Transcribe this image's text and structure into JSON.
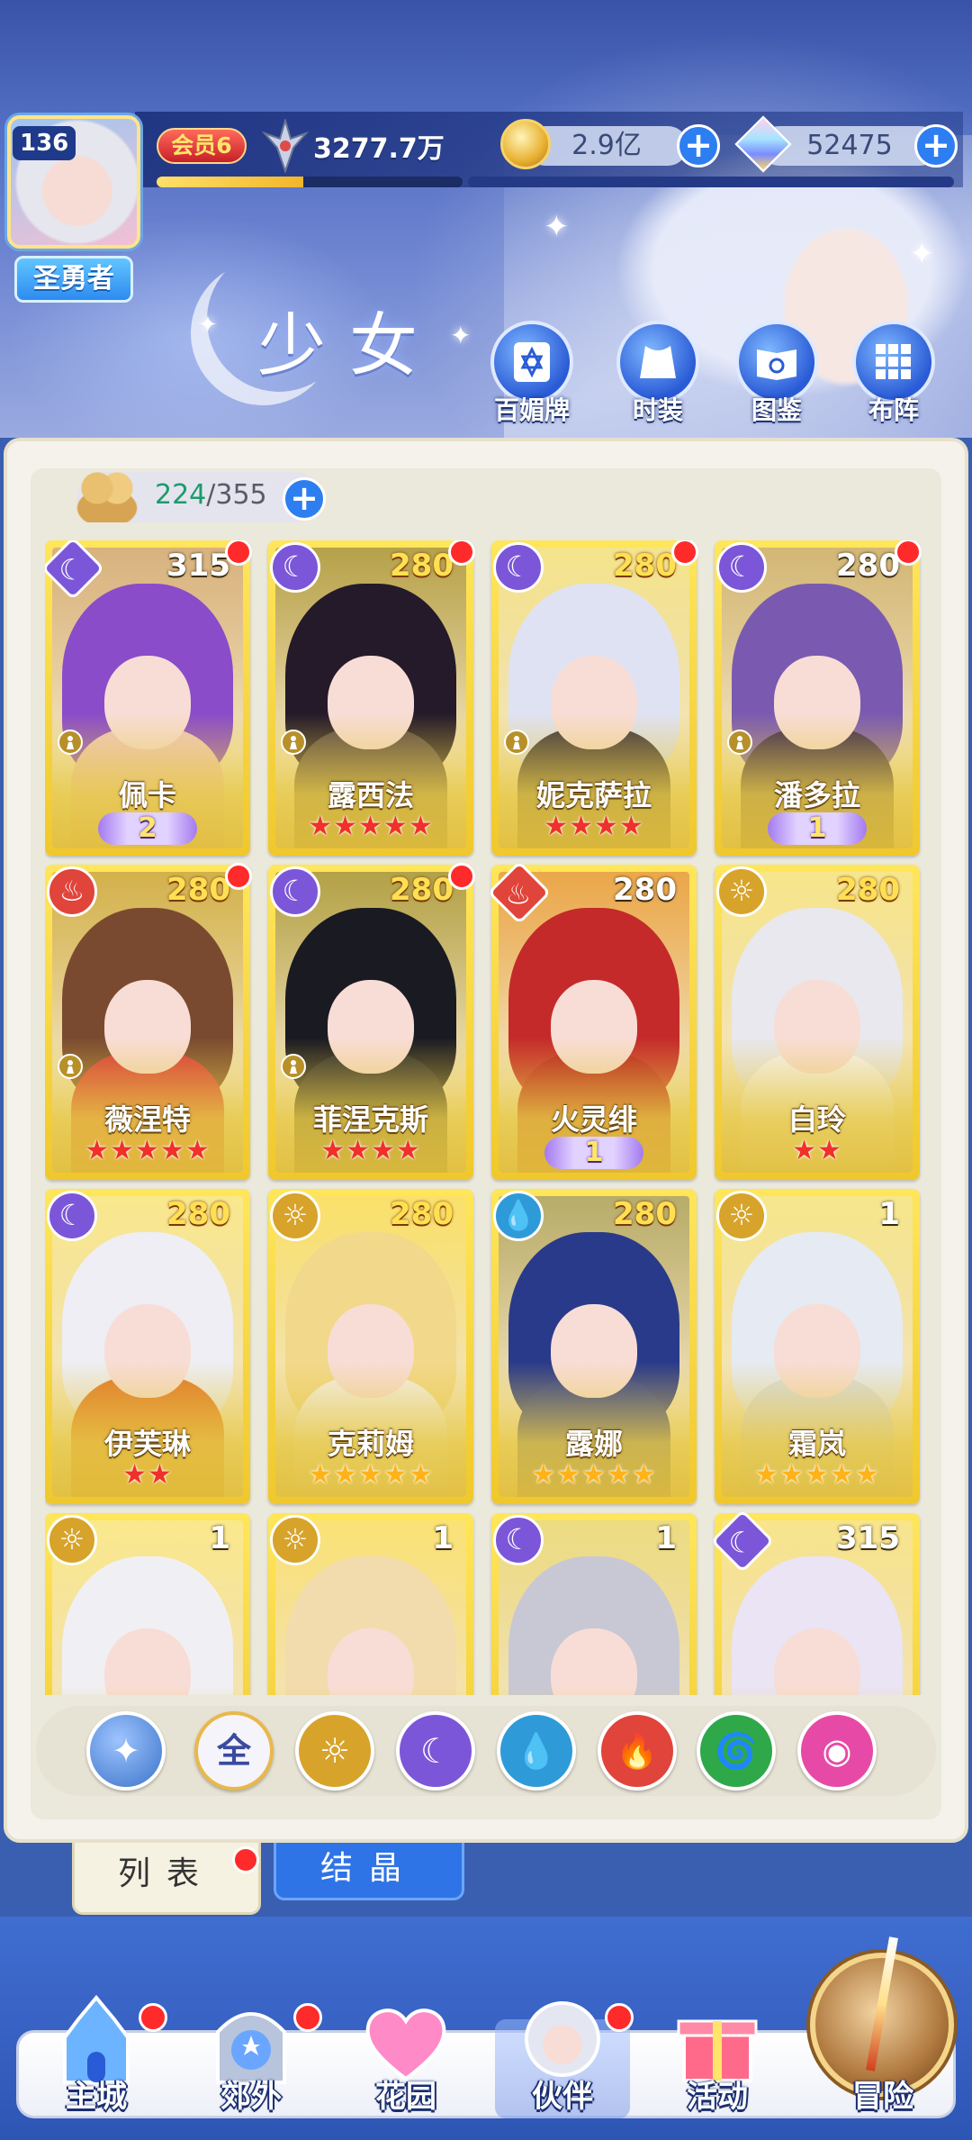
{
  "header": {
    "avatar_level": "136",
    "title_badge": "圣勇者",
    "vip": "会员6",
    "power": "3277.7万",
    "exp_progress": 0.48,
    "coins": "2.9亿",
    "gems": "52475"
  },
  "page": {
    "title": "少女",
    "menu": [
      {
        "label": "百媚牌",
        "icon": "hexagram-card-icon"
      },
      {
        "label": "时装",
        "icon": "outfit-icon"
      },
      {
        "label": "图鉴",
        "icon": "book-icon"
      },
      {
        "label": "布阵",
        "icon": "grid-formation-icon"
      }
    ]
  },
  "roster": {
    "current": "224",
    "total": "355"
  },
  "colors": {
    "card_gold": "#f0c82c",
    "dark": "#7c56d8",
    "light": "#d7a32a",
    "fire": "#e0443a",
    "water": "#2f9ad8",
    "wind": "#2fa84a",
    "pink": "#e64aa6",
    "accent_blue": "#2d7ef0",
    "star_red": "#f0302a",
    "star_gold": "#ffb31a"
  },
  "cards": [
    {
      "name": "佩卡",
      "level": "315",
      "element": "dark",
      "diamond": true,
      "level_gold": false,
      "dot": true,
      "lock": true,
      "wing": "2",
      "stars": 0,
      "star_color": "",
      "hair": "#8a4cc8",
      "outfit": "#f0c8c0"
    },
    {
      "name": "露西法",
      "level": "280",
      "element": "dark",
      "diamond": false,
      "level_gold": true,
      "dot": true,
      "lock": true,
      "wing": "",
      "stars": 5,
      "star_color": "red",
      "hair": "#241a2a",
      "outfit": "#5a4a4a"
    },
    {
      "name": "妮克萨拉",
      "level": "280",
      "element": "dark",
      "diamond": false,
      "level_gold": true,
      "dot": true,
      "lock": true,
      "wing": "",
      "stars": 4,
      "star_color": "red",
      "hair": "#dfe2f2",
      "outfit": "#3a3240"
    },
    {
      "name": "潘多拉",
      "level": "280",
      "element": "dark",
      "diamond": false,
      "level_gold": false,
      "dot": true,
      "lock": true,
      "wing": "1",
      "stars": 0,
      "star_color": "",
      "hair": "#7a5ab0",
      "outfit": "#3a2a50"
    },
    {
      "name": "薇涅特",
      "level": "280",
      "element": "fire",
      "diamond": false,
      "level_gold": true,
      "dot": true,
      "lock": true,
      "wing": "",
      "stars": 5,
      "star_color": "red",
      "hair": "#7a4a30",
      "outfit": "#d83a3a"
    },
    {
      "name": "菲涅克斯",
      "level": "280",
      "element": "dark",
      "diamond": false,
      "level_gold": true,
      "dot": true,
      "lock": true,
      "wing": "",
      "stars": 4,
      "star_color": "red",
      "hair": "#1a1a22",
      "outfit": "#2a2a30"
    },
    {
      "name": "火灵绯",
      "level": "280",
      "element": "fire",
      "diamond": true,
      "level_gold": false,
      "dot": false,
      "lock": false,
      "wing": "1",
      "stars": 0,
      "star_color": "",
      "hair": "#c42a2a",
      "outfit": "#b82020"
    },
    {
      "name": "白玲",
      "level": "280",
      "element": "light",
      "diamond": false,
      "level_gold": true,
      "dot": false,
      "lock": false,
      "wing": "",
      "stars": 2,
      "star_color": "red",
      "hair": "#e8e8ee",
      "outfit": "#f6f4f4"
    },
    {
      "name": "伊芙琳",
      "level": "280",
      "element": "dark",
      "diamond": false,
      "level_gold": true,
      "dot": false,
      "lock": false,
      "wing": "",
      "stars": 2,
      "star_color": "red",
      "hair": "#eeeef4",
      "outfit": "#e0782a"
    },
    {
      "name": "克莉姆",
      "level": "280",
      "element": "light",
      "diamond": false,
      "level_gold": true,
      "dot": false,
      "lock": false,
      "wing": "",
      "stars": 5,
      "star_color": "gold",
      "hair": "#f2d88a",
      "outfit": "#f4f0ea"
    },
    {
      "name": "露娜",
      "level": "280",
      "element": "water",
      "diamond": false,
      "level_gold": true,
      "dot": false,
      "lock": false,
      "wing": "",
      "stars": 5,
      "star_color": "gold",
      "hair": "#2a3a8a",
      "outfit": "#2e3e90"
    },
    {
      "name": "霜岚",
      "level": "1",
      "element": "light",
      "diamond": false,
      "level_gold": false,
      "dot": false,
      "lock": false,
      "wing": "",
      "stars": 5,
      "star_color": "gold",
      "hair": "#e6eaf2",
      "outfit": "#d8dce4"
    },
    {
      "name": "",
      "level": "1",
      "element": "light",
      "diamond": false,
      "level_gold": false,
      "dot": false,
      "lock": false,
      "wing": "",
      "stars": 0,
      "star_color": "",
      "hair": "#f0f0f4",
      "outfit": "#e4e0e0"
    },
    {
      "name": "",
      "level": "1",
      "element": "light",
      "diamond": false,
      "level_gold": false,
      "dot": false,
      "lock": false,
      "wing": "",
      "stars": 0,
      "star_color": "",
      "hair": "#f2dcae",
      "outfit": "#a07040"
    },
    {
      "name": "",
      "level": "1",
      "element": "dark",
      "diamond": false,
      "level_gold": false,
      "dot": false,
      "lock": false,
      "wing": "",
      "stars": 0,
      "star_color": "",
      "hair": "#c8c8d4",
      "outfit": "#5a3a70"
    },
    {
      "name": "",
      "level": "315",
      "element": "dark",
      "diamond": true,
      "level_gold": false,
      "dot": false,
      "lock": false,
      "wing": "",
      "stars": 0,
      "star_color": "",
      "hair": "#eae4f4",
      "outfit": "#f4f0f6"
    }
  ],
  "filters": [
    {
      "key": "special",
      "label": "✦",
      "color": "#3b73c8",
      "icon": "arrow-up-star-icon"
    },
    {
      "key": "all",
      "label": "全",
      "color": "#f4f4fa",
      "icon": "all-filter-icon"
    },
    {
      "key": "light",
      "label": "☼",
      "color": "#d7a32a",
      "icon": "light-element-icon"
    },
    {
      "key": "dark",
      "label": "☾",
      "color": "#7c56d8",
      "icon": "dark-element-icon"
    },
    {
      "key": "water",
      "label": "💧",
      "color": "#2f9ad8",
      "icon": "water-element-icon"
    },
    {
      "key": "fire",
      "label": "🔥",
      "color": "#e0443a",
      "icon": "fire-element-icon"
    },
    {
      "key": "wind",
      "label": "🌀",
      "color": "#2fa84a",
      "icon": "wind-element-icon"
    },
    {
      "key": "pink",
      "label": "◉",
      "color": "#e64aa6",
      "icon": "chaos-element-icon"
    }
  ],
  "tabs": {
    "list": "列表",
    "crystal": "结晶"
  },
  "nav": [
    {
      "label": "主城",
      "icon": "castle-icon",
      "dot": true,
      "active": false
    },
    {
      "label": "郊外",
      "icon": "portal-icon",
      "dot": true,
      "active": false
    },
    {
      "label": "花园",
      "icon": "heart-icon",
      "dot": false,
      "active": false
    },
    {
      "label": "伙伴",
      "icon": "partner-avatar-icon",
      "dot": true,
      "active": true
    },
    {
      "label": "活动",
      "icon": "gift-box-icon",
      "dot": false,
      "active": false
    }
  ],
  "adventure_label": "冒险"
}
